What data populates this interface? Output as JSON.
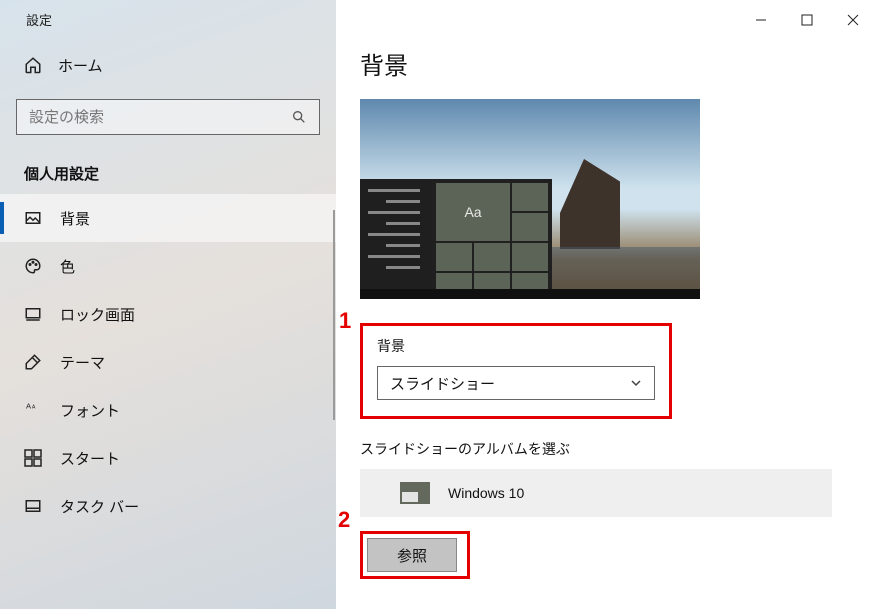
{
  "window": {
    "title": "設定"
  },
  "sidebar": {
    "home": "ホーム",
    "search_placeholder": "設定の検索",
    "section": "個人用設定",
    "items": [
      {
        "label": "背景",
        "selected": true,
        "icon": "picture-icon"
      },
      {
        "label": "色",
        "selected": false,
        "icon": "palette-icon"
      },
      {
        "label": "ロック画面",
        "selected": false,
        "icon": "lockscreen-icon"
      },
      {
        "label": "テーマ",
        "selected": false,
        "icon": "theme-icon"
      },
      {
        "label": "フォント",
        "selected": false,
        "icon": "font-icon"
      },
      {
        "label": "スタート",
        "selected": false,
        "icon": "start-icon"
      },
      {
        "label": "タスク バー",
        "selected": false,
        "icon": "taskbar-icon"
      }
    ]
  },
  "main": {
    "heading": "背景",
    "preview_tile_text": "Aa",
    "bg_label": "背景",
    "bg_value": "スライドショー",
    "album_label": "スライドショーのアルバムを選ぶ",
    "album_name": "Windows 10",
    "browse": "参照"
  },
  "callouts": {
    "one": "1",
    "two": "2"
  },
  "colors": {
    "accent": "#0a5fb5",
    "highlight": "#e50000"
  }
}
